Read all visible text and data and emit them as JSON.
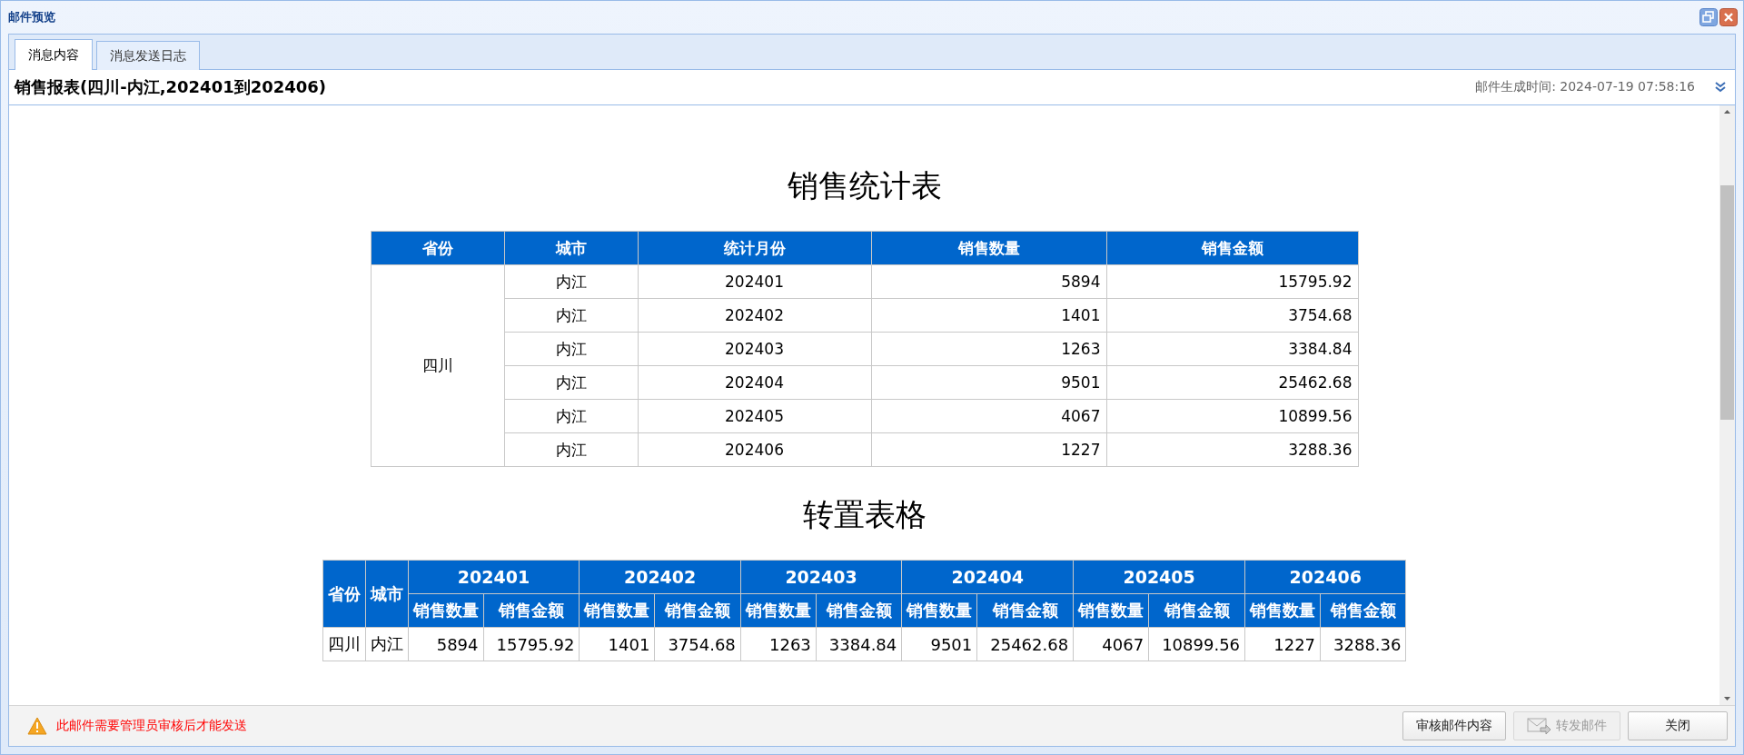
{
  "window": {
    "title": "邮件预览"
  },
  "tabs": [
    {
      "label": "消息内容",
      "selected": true
    },
    {
      "label": "消息发送日志",
      "selected": false
    }
  ],
  "subject": {
    "title": "销售报表(四川-内江,202401到202406)",
    "generated": "邮件生成时间: 2024-07-19 07:58:16"
  },
  "sales_table": {
    "title": "销售统计表",
    "columns": [
      "省份",
      "城市",
      "统计月份",
      "销售数量",
      "销售金额"
    ],
    "groups": [
      {
        "province": "四川",
        "rows": [
          {
            "city": "内江",
            "month": "202401",
            "qty": "5894",
            "amount": "15795.92"
          },
          {
            "city": "内江",
            "month": "202402",
            "qty": "1401",
            "amount": "3754.68"
          },
          {
            "city": "内江",
            "month": "202403",
            "qty": "1263",
            "amount": "3384.84"
          },
          {
            "city": "内江",
            "month": "202404",
            "qty": "9501",
            "amount": "25462.68"
          },
          {
            "city": "内江",
            "month": "202405",
            "qty": "4067",
            "amount": "10899.56"
          },
          {
            "city": "内江",
            "month": "202406",
            "qty": "1227",
            "amount": "3288.36"
          }
        ]
      }
    ]
  },
  "transposed_table": {
    "title": "转置表格",
    "fixed_columns": [
      "省份",
      "城市"
    ],
    "periods": [
      {
        "month": "202401",
        "columns": [
          "销售数量",
          "销售金额"
        ]
      },
      {
        "month": "202402",
        "columns": [
          "销售数量",
          "销售金额"
        ]
      },
      {
        "month": "202403",
        "columns": [
          "销售数量",
          "销售金额"
        ]
      },
      {
        "month": "202404",
        "columns": [
          "销售数量",
          "销售金额"
        ]
      },
      {
        "month": "202405",
        "columns": [
          "销售数量",
          "销售金额"
        ]
      },
      {
        "month": "202406",
        "columns": [
          "销售数量",
          "销售金额"
        ]
      }
    ],
    "rows": [
      {
        "province": "四川",
        "city": "内江",
        "values": [
          "5894",
          "15795.92",
          "1401",
          "3754.68",
          "1263",
          "3384.84",
          "9501",
          "25462.68",
          "4067",
          "10899.56",
          "1227",
          "3288.36"
        ]
      }
    ]
  },
  "footer": {
    "warning": "此邮件需要管理员审核后才能发送",
    "buttons": [
      {
        "label": "审核邮件内容",
        "disabled": false,
        "kind": "text"
      },
      {
        "label": "转发邮件",
        "disabled": true,
        "kind": "mail"
      },
      {
        "label": "关闭",
        "disabled": false,
        "kind": "text"
      }
    ]
  }
}
